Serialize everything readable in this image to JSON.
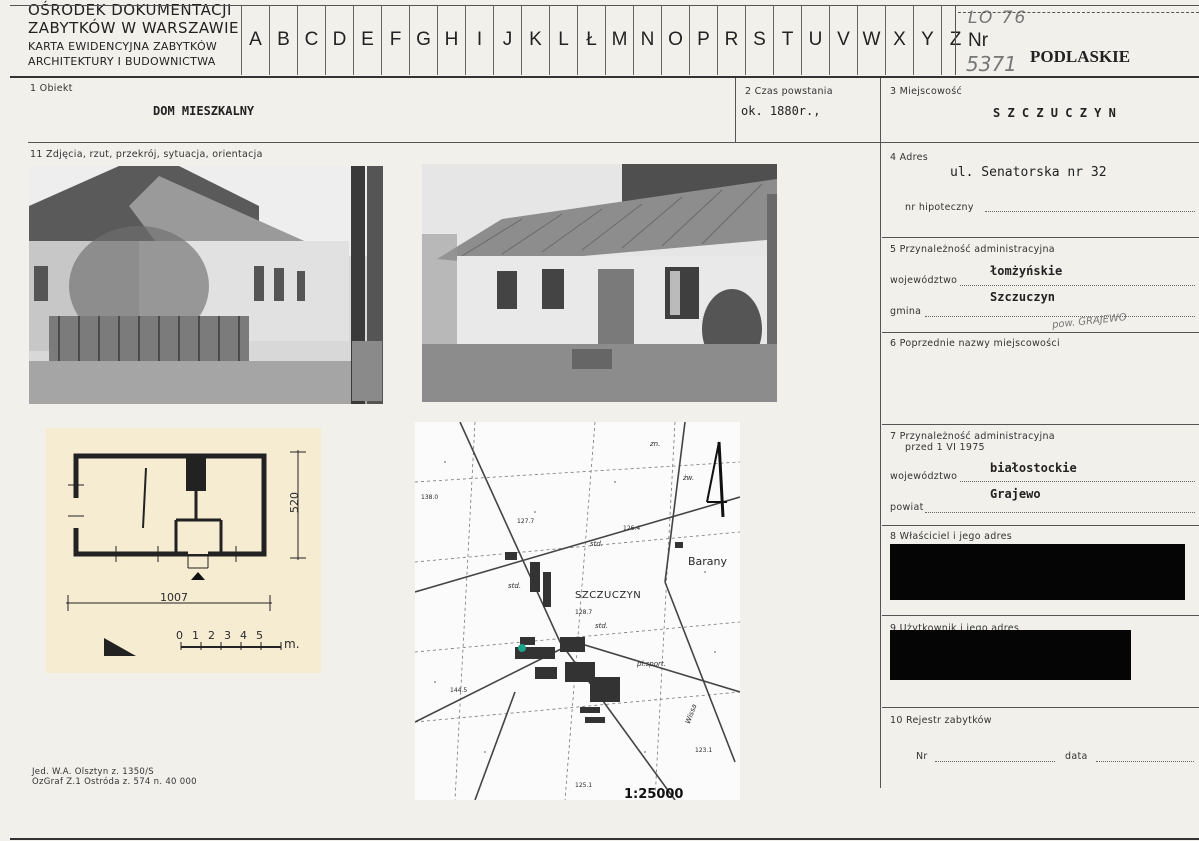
{
  "header": {
    "line1": "OŚRODEK DOKUMENTACJI",
    "line2": "ZABYTKÓW W WARSZAWIE",
    "line3": "KARTA EWIDENCYJNA ZABYTKÓW",
    "line4": "ARCHITEKTURY I BUDOWNICTWA",
    "letters": [
      "A",
      "B",
      "C",
      "D",
      "E",
      "F",
      "G",
      "H",
      "I",
      "J",
      "K",
      "L",
      "Ł",
      "M",
      "N",
      "O",
      "P",
      "R",
      "S",
      "T",
      "U",
      "V",
      "W",
      "X",
      "Y",
      "Z"
    ],
    "nr_label": "Nr",
    "code_handwritten": "LO 76",
    "nr_handwritten": "5371",
    "region": "PODLASKIE"
  },
  "fields": {
    "f1_label": "1 Obiekt",
    "f1_value": "DOM MIESZKALNY",
    "f2_label": "2 Czas powstania",
    "f2_value": "ok. 1880r.,",
    "f3_label": "3 Miejscowość",
    "f3_value": "S Z C Z U C Z Y N",
    "f11_label": "11 Zdjęcia, rzut, przekrój, sytuacja, orientacja",
    "f4_label": "4 Adres",
    "f4_value": "ul. Senatorska nr 32",
    "f4_sub": "nr hipoteczny",
    "f5_label": "5 Przynależność administracyjna",
    "f5_woj_label": "województwo",
    "f5_woj_value": "łomżyńskie",
    "f5_gmina_label": "gmina",
    "f5_gmina_value": "Szczuczyn",
    "f5_handwritten": "pow. GRAJEWO",
    "f6_label": "6 Poprzednie nazwy miejscowości",
    "f7_label": "7 Przynależność administracyjna",
    "f7_label2": "przed 1 VI 1975",
    "f7_woj_label": "województwo",
    "f7_woj_value": "białostockie",
    "f7_pow_label": "powiat",
    "f7_pow_value": "Grajewo",
    "f8_label": "8 Właściciel i jego adres",
    "f9_label": "9 Użytkownik i jego adres",
    "f10_label": "10 Rejestr zabytków",
    "f10_nr_label": "Nr",
    "f10_data_label": "data"
  },
  "plan": {
    "dim_vertical": "520",
    "dim_horizontal": "1007",
    "scale_labels": [
      "0",
      "1",
      "2",
      "3",
      "4",
      "5"
    ],
    "scale_unit": "m."
  },
  "map": {
    "town": "SZCZUCZYN",
    "village": "Barany",
    "scale": "1:25000",
    "north_mark": "4",
    "labels": [
      "138.0",
      "127.7",
      "126.4",
      "std.",
      "std.",
      "std.",
      "128.7",
      "pl.sport.",
      "144.5",
      "123.1",
      "125.1",
      "zn.",
      "żw.",
      "Wissa"
    ]
  },
  "footer": {
    "line1": "Jed. W.A. Olsztyn z. 1350/S",
    "line2": "OzGraf Z.1 Ostróda z. 574 n. 40 000"
  }
}
